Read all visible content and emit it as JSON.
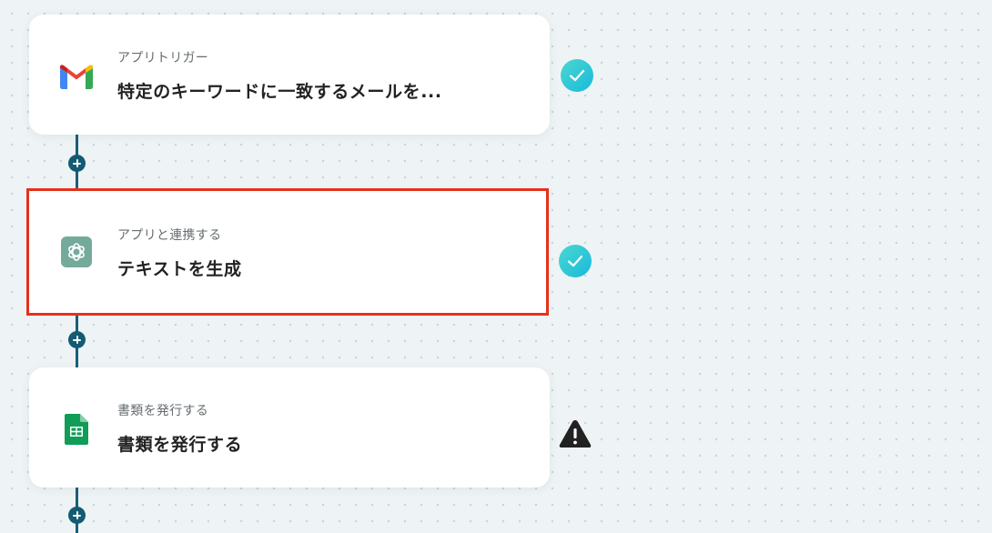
{
  "steps": [
    {
      "subtitle": "アプリトリガー",
      "title": "特定のキーワードに一致するメールを...",
      "icon": "gmail-icon",
      "status": "success"
    },
    {
      "subtitle": "アプリと連携する",
      "title": "テキストを生成",
      "icon": "chatgpt-icon",
      "status": "success",
      "highlighted": true
    },
    {
      "subtitle": "書類を発行する",
      "title": "書類を発行する",
      "icon": "google-sheets-icon",
      "status": "warning"
    }
  ],
  "colors": {
    "connector": "#135b73",
    "success": "#1fc1d8",
    "warning": "#222222",
    "highlight_border": "#e8301a"
  }
}
